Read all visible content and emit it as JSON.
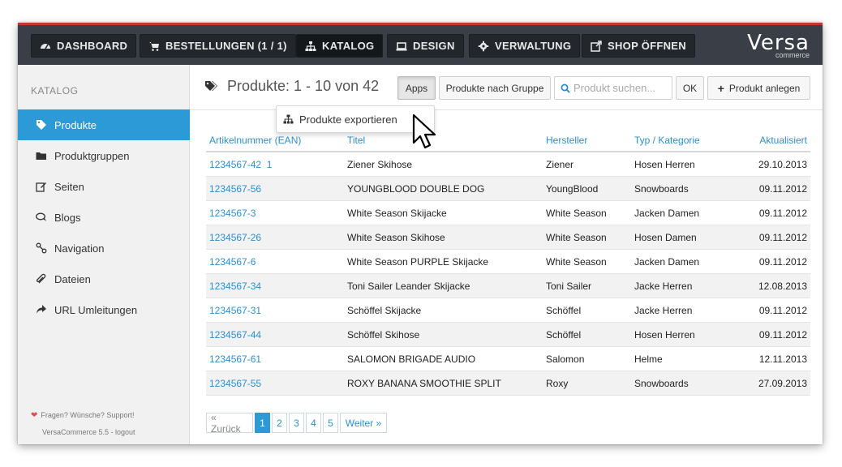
{
  "nav": {
    "dashboard": "DASHBOARD",
    "bestellungen": "BESTELLUNGEN (1 / 1)",
    "katalog": "KATALOG",
    "design": "DESIGN",
    "verwaltung": "VERWALTUNG",
    "shop_oeffnen": "SHOP ÖFFNEN"
  },
  "logo": {
    "word": "Versa",
    "sub": "commerce"
  },
  "sidebar": {
    "heading": "KATALOG",
    "items": [
      {
        "label": "Produkte",
        "icon": "tags-icon"
      },
      {
        "label": "Produktgruppen",
        "icon": "folder-icon"
      },
      {
        "label": "Seiten",
        "icon": "edit-icon"
      },
      {
        "label": "Blogs",
        "icon": "comments-icon"
      },
      {
        "label": "Navigation",
        "icon": "sitemap-icon"
      },
      {
        "label": "Dateien",
        "icon": "paperclip-icon"
      },
      {
        "label": "URL Umleitungen",
        "icon": "share-icon"
      }
    ],
    "footer_support": "Fragen? Wünsche? Support!",
    "footer_version": "VersaCommerce 5.5 - logout"
  },
  "toolbar": {
    "title": "Produkte: 1 - 10 von 42",
    "apps": "Apps",
    "nach_gruppe": "Produkte nach Gruppe",
    "search_placeholder": "Produkt suchen...",
    "ok": "OK",
    "anlegen": "Produkt anlegen"
  },
  "dropdown": {
    "export": "Produkte exportieren"
  },
  "table": {
    "headers": [
      "Artikelnummer (EAN)",
      "Titel",
      "Hersteller",
      "Typ / Kategorie",
      "Aktualisiert"
    ],
    "rows": [
      [
        "1234567-42  1",
        "Ziener Skihose",
        "Ziener",
        "Hosen Herren",
        "29.10.2013"
      ],
      [
        "1234567-56",
        "YOUNGBLOOD DOUBLE DOG",
        "YoungBlood",
        "Snowboards",
        "09.11.2012"
      ],
      [
        "1234567-3",
        "White Season Skijacke",
        "White Season",
        "Jacken Damen",
        "09.11.2012"
      ],
      [
        "1234567-26",
        "White Season Skihose",
        "White Season",
        "Hosen Damen",
        "09.11.2012"
      ],
      [
        "1234567-6",
        "White Season PURPLE Skijacke",
        "White Season",
        "Jacken Damen",
        "09.11.2012"
      ],
      [
        "1234567-34",
        "Toni Sailer Leander Skijacke",
        "Toni Sailer",
        "Jacke Herren",
        "12.08.2013"
      ],
      [
        "1234567-31",
        "Schöffel Skijacke",
        "Schöffel",
        "Jacke Herren",
        "09.11.2012"
      ],
      [
        "1234567-44",
        "Schöffel Skihose",
        "Schöffel",
        "Hosen Herren",
        "09.11.2012"
      ],
      [
        "1234567-61",
        "SALOMON BRIGADE AUDIO",
        "Salomon",
        "Helme",
        "12.11.2013"
      ],
      [
        "1234567-55",
        "ROXY BANANA SMOOTHIE SPLIT",
        "Roxy",
        "Snowboards",
        "27.09.2013"
      ]
    ]
  },
  "pager": {
    "prev": "« Zurück",
    "pages": [
      "1",
      "2",
      "3",
      "4",
      "5"
    ],
    "next": "Weiter »",
    "current": "1"
  },
  "colors": {
    "accent": "#2d9ad8",
    "topbar": "#3a3f47",
    "brand_red": "#c0392b",
    "link": "#2d8fcf"
  }
}
